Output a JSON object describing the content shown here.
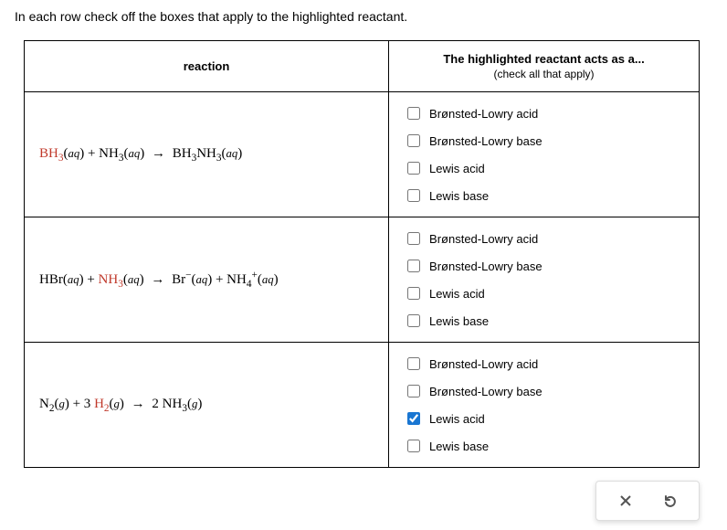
{
  "instruction": "In each row check off the boxes that apply to the highlighted reactant.",
  "headers": {
    "reaction": "reaction",
    "acts_as": "The highlighted reactant acts as a...",
    "acts_as_sub": "(check all that apply)"
  },
  "option_labels": {
    "bl_acid": "Brønsted-Lowry acid",
    "bl_base": "Brønsted-Lowry base",
    "lewis_acid": "Lewis acid",
    "lewis_base": "Lewis base"
  },
  "rows": [
    {
      "reaction_html": "<span class='hl'>BH<sub>3</sub></span>(<span class='state'>aq</span>) + NH<sub>3</sub>(<span class='state'>aq</span>) <span class='arrow'>→</span> BH<sub>3</sub>NH<sub>3</sub>(<span class='state'>aq</span>)",
      "checked": {
        "bl_acid": false,
        "bl_base": false,
        "lewis_acid": false,
        "lewis_base": false
      }
    },
    {
      "reaction_html": "HBr(<span class='state'>aq</span>) + <span class='hl'>NH<sub>3</sub></span>(<span class='state'>aq</span>) <span class='arrow'>→</span> Br<sup>−</sup>(<span class='state'>aq</span>) + NH<sub>4</sub><sup>+</sup>(<span class='state'>aq</span>)",
      "checked": {
        "bl_acid": false,
        "bl_base": false,
        "lewis_acid": false,
        "lewis_base": false
      }
    },
    {
      "reaction_html": "N<sub>2</sub>(<span class='state'>g</span>) + 3 <span class='hl'>H<sub>2</sub></span>(<span class='state'>g</span>) <span class='arrow'>→</span> 2 NH<sub>3</sub>(<span class='state'>g</span>)",
      "checked": {
        "bl_acid": false,
        "bl_base": false,
        "lewis_acid": true,
        "lewis_base": false
      }
    }
  ]
}
